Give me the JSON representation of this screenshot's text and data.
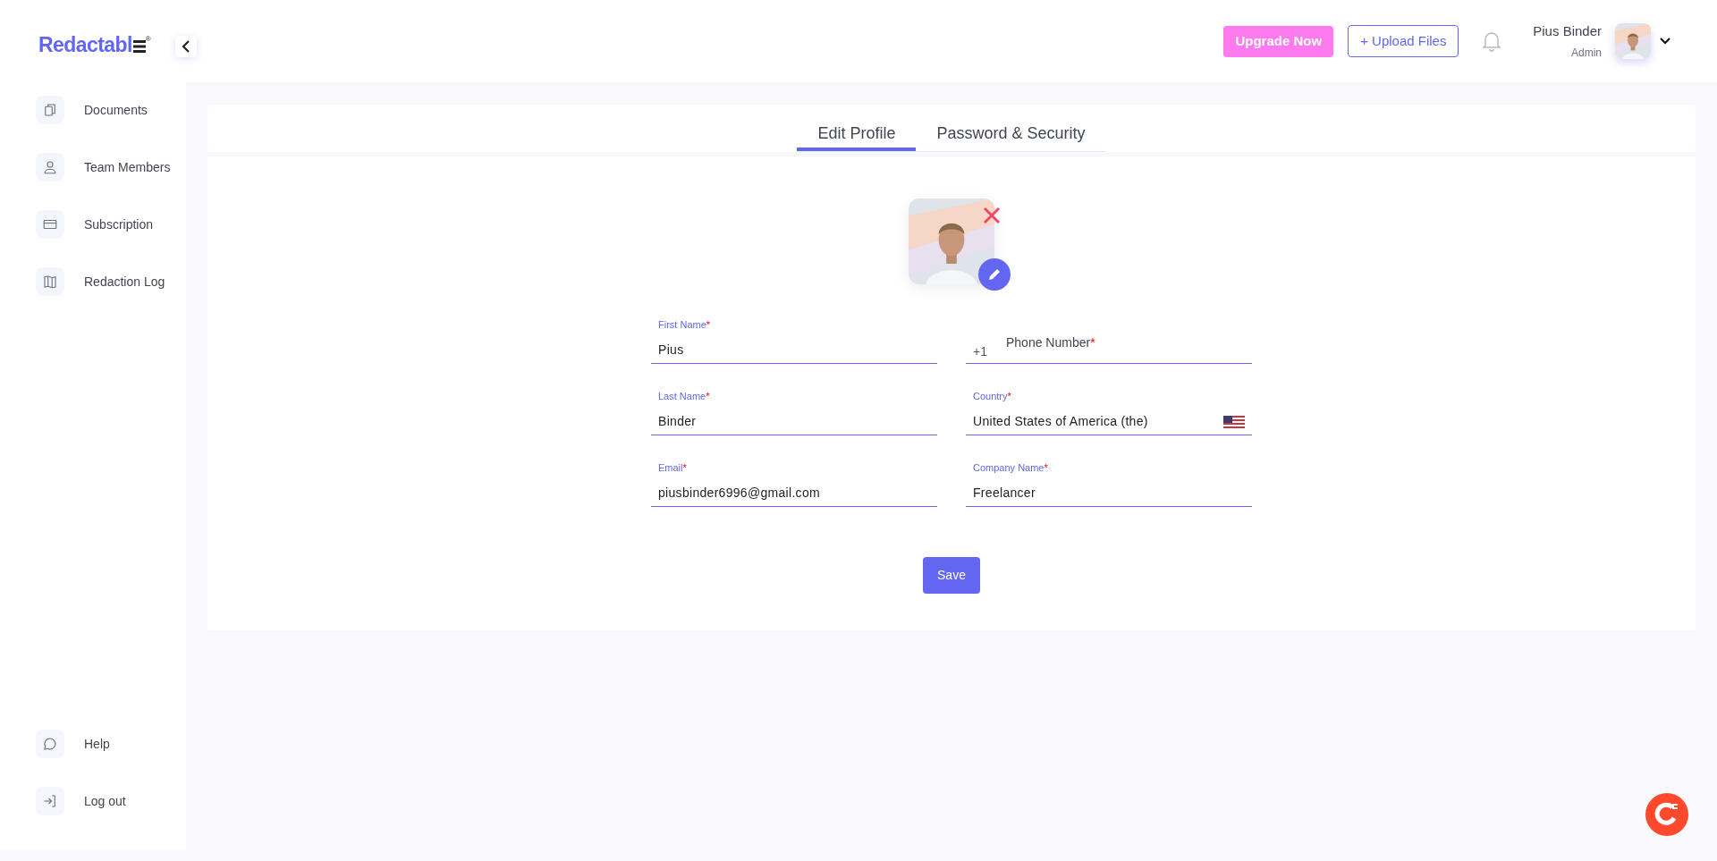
{
  "logo": {
    "text": "Redactabl",
    "mark": "®"
  },
  "sidebar": {
    "items": [
      {
        "label": "Documents"
      },
      {
        "label": "Team Members"
      },
      {
        "label": "Subscription"
      },
      {
        "label": "Redaction Log"
      }
    ],
    "footer_items": [
      {
        "label": "Help"
      },
      {
        "label": "Log out"
      }
    ]
  },
  "header": {
    "upgrade_button": "Upgrade Now",
    "upload_button": "+ Upload Files",
    "user": {
      "name": "Pius Binder",
      "role": "Admin"
    }
  },
  "tabs": [
    {
      "label": "Edit Profile",
      "selected": true
    },
    {
      "label": "Password & Security",
      "selected": false
    }
  ],
  "form": {
    "fields": [
      {
        "label": "First Name",
        "required_mark": "*",
        "value": "Pius",
        "kind": "text"
      },
      {
        "label": "Phone Number",
        "required_mark": "*",
        "prefix": "+1",
        "kind": "phone"
      },
      {
        "label": "Last Name",
        "required_mark": "*",
        "value": "Binder",
        "kind": "text"
      },
      {
        "label": "Country",
        "required_mark": "*",
        "value": "United States of America (the)",
        "kind": "country"
      },
      {
        "label": "Email",
        "required_mark": "*",
        "value": "piusbinder6996@gmail.com",
        "kind": "text"
      },
      {
        "label": "Company Name",
        "required_mark": "*",
        "value": "Freelancer",
        "kind": "text"
      }
    ],
    "save_button": "Save"
  }
}
